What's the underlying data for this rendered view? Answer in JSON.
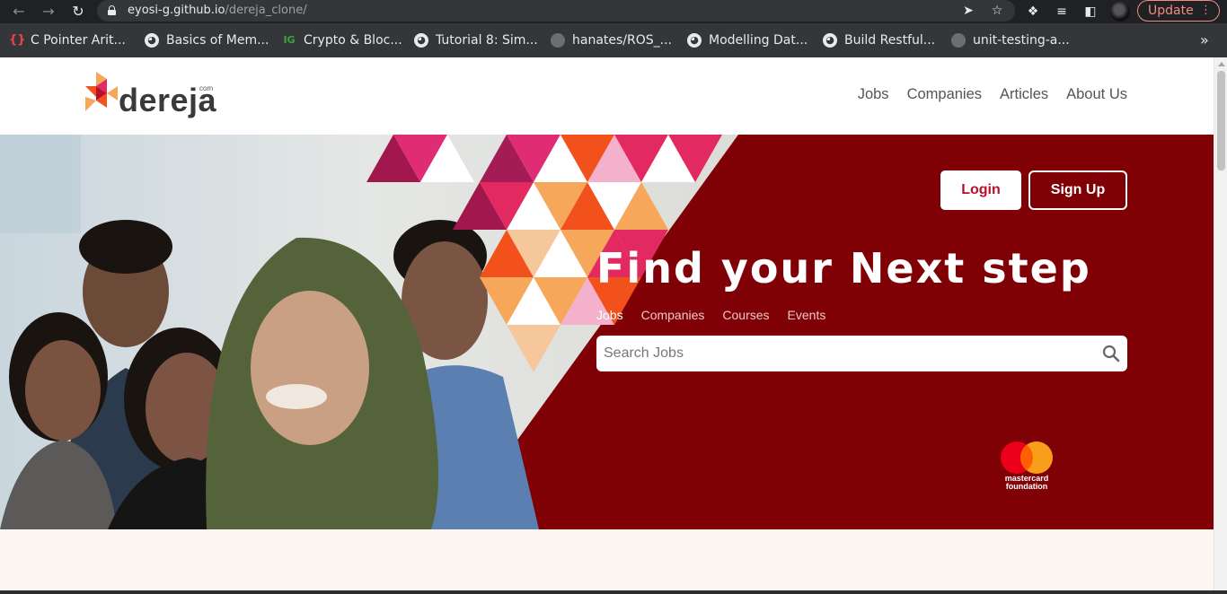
{
  "browser": {
    "url_host": "eyosi-g.github.io",
    "url_path": "/dereja_clone/",
    "update_label": "Update",
    "icons": [
      "back-icon",
      "forward-icon",
      "reload-icon",
      "lock-icon",
      "send-icon",
      "star-icon",
      "puzzle-icon",
      "playlist-icon",
      "sidepanel-icon",
      "kebab-icon"
    ],
    "bookmarks": [
      {
        "label": "C Pointer Arit...",
        "icon": "brace"
      },
      {
        "label": "Basics of Mem...",
        "icon": "globe"
      },
      {
        "label": "Crypto & Bloc...",
        "icon": "ig"
      },
      {
        "label": "Tutorial 8: Sim...",
        "icon": "globe"
      },
      {
        "label": "hanates/ROS_...",
        "icon": "github"
      },
      {
        "label": "Modelling Dat...",
        "icon": "globe"
      },
      {
        "label": "Build Restful...",
        "icon": "globe"
      },
      {
        "label": "unit-testing-a...",
        "icon": "github"
      }
    ]
  },
  "site": {
    "logo_text": "dereja",
    "logo_suffix": "com",
    "nav": [
      "Jobs",
      "Companies",
      "Articles",
      "About Us"
    ],
    "login_label": "Login",
    "signup_label": "Sign Up",
    "hero_title": "Find your Next step",
    "search_tabs": [
      "Jobs",
      "Companies",
      "Courses",
      "Events"
    ],
    "active_search_tab": "Jobs",
    "search_placeholder": "Search Jobs",
    "partner_line1": "mastercard",
    "partner_line2": "foundation"
  },
  "colors": {
    "hero_bg": "#7f0106",
    "accent": "#b8102c",
    "pink": "#e32a60",
    "orange": "#f2511b",
    "light_orange": "#f6a75a"
  }
}
